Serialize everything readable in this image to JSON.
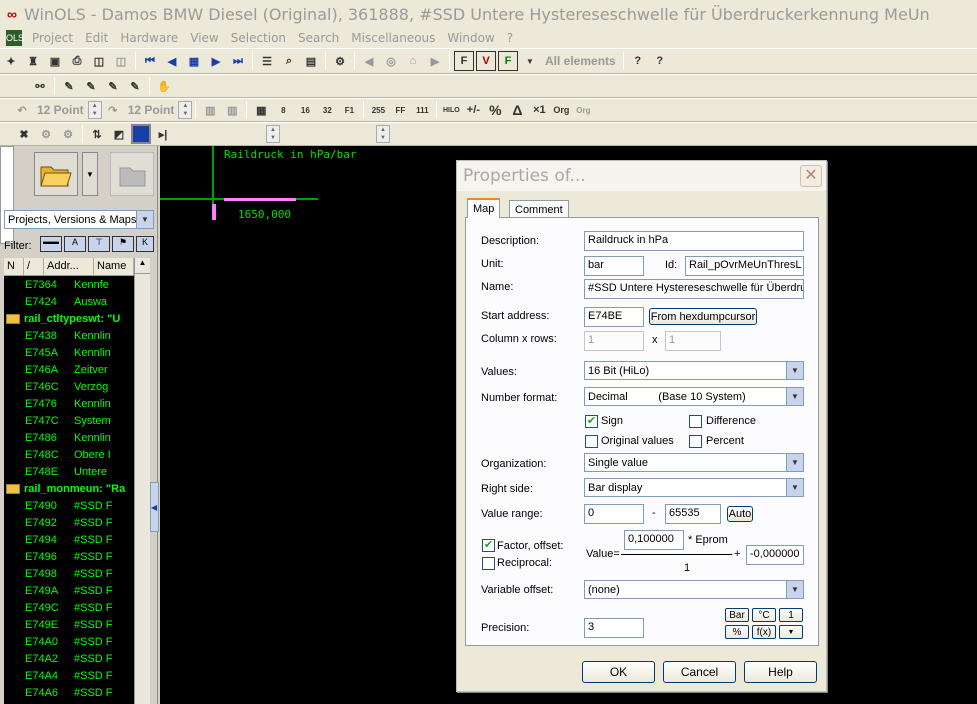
{
  "window": {
    "title": "WinOLS - Damos BMW Diesel (Original), 361888, #SSD Untere Hystereseschwelle für Überdruckerkennung MeUn"
  },
  "menu": [
    "Project",
    "Edit",
    "Hardware",
    "View",
    "Selection",
    "Search",
    "Miscellaneous",
    "Window",
    "?"
  ],
  "toolbar": {
    "filter_label": "All elements",
    "font1": "12 Point",
    "font2": "12 Point"
  },
  "leftpanel": {
    "combo_label": "Projects, Versions & Maps:",
    "filter_label": "Filter:",
    "list_columns": [
      "N",
      "/",
      "Addr...",
      "Name"
    ],
    "rows": [
      {
        "type": "item",
        "addr": "E7364",
        "name": "Kennfe"
      },
      {
        "type": "item",
        "addr": "E7424",
        "name": "Auswa"
      },
      {
        "type": "folder",
        "label": "rail_ctltypeswt: \"U"
      },
      {
        "type": "item",
        "addr": "E7438",
        "name": "Kennlin"
      },
      {
        "type": "item",
        "addr": "E745A",
        "name": "Kennlin"
      },
      {
        "type": "item",
        "addr": "E746A",
        "name": "Zeitver"
      },
      {
        "type": "item",
        "addr": "E746C",
        "name": "Verzög"
      },
      {
        "type": "item",
        "addr": "E7476",
        "name": "Kennlin"
      },
      {
        "type": "item",
        "addr": "E747C",
        "name": "System"
      },
      {
        "type": "item",
        "addr": "E7486",
        "name": "Kennlin"
      },
      {
        "type": "item",
        "addr": "E748C",
        "name": "Obere I"
      },
      {
        "type": "item",
        "addr": "E748E",
        "name": "Untere"
      },
      {
        "type": "folder",
        "label": "rail_monmeun: \"Ra"
      },
      {
        "type": "item",
        "addr": "E7490",
        "name": "#SSD F"
      },
      {
        "type": "item",
        "addr": "E7492",
        "name": "#SSD F"
      },
      {
        "type": "item",
        "addr": "E7494",
        "name": "#SSD F"
      },
      {
        "type": "item",
        "addr": "E7496",
        "name": "#SSD F"
      },
      {
        "type": "item",
        "addr": "E7498",
        "name": "#SSD F"
      },
      {
        "type": "item",
        "addr": "E749A",
        "name": "#SSD F"
      },
      {
        "type": "item",
        "addr": "E749C",
        "name": "#SSD F"
      },
      {
        "type": "item",
        "addr": "E749E",
        "name": "#SSD F"
      },
      {
        "type": "item",
        "addr": "E74A0",
        "name": "#SSD F"
      },
      {
        "type": "item",
        "addr": "E74A2",
        "name": "#SSD F"
      },
      {
        "type": "item",
        "addr": "E74A4",
        "name": "#SSD F"
      },
      {
        "type": "item",
        "addr": "E74A6",
        "name": "#SSD F"
      }
    ]
  },
  "map": {
    "axis_label": "Raildruck in hPa/bar",
    "value": "1650,000"
  },
  "dialog": {
    "title": "Properties of...",
    "tabs": [
      "Map",
      "Comment"
    ],
    "description_label": "Description:",
    "description": "Raildruck in hPa",
    "unit_label": "Unit:",
    "unit": "bar",
    "id_label": "Id:",
    "id": "Rail_pOvrMeUnThresL",
    "name_label": "Name:",
    "name": "#SSD Untere Hystereseschwelle für Überdru",
    "start_label": "Start address:",
    "start": "E74BE",
    "from_hexdump": "From hexdumpcursor",
    "colrows_label": "Column x rows:",
    "cols": "1",
    "x": "x",
    "rows": "1",
    "values_label": "Values:",
    "values": "16 Bit (HiLo)",
    "numfmt_label": "Number format:",
    "numfmt": "Decimal          (Base 10 System)",
    "sign": "Sign",
    "difference": "Difference",
    "original": "Original values",
    "percent": "Percent",
    "org_label": "Organization:",
    "org": "Single value",
    "right_label": "Right side:",
    "right": "Bar display",
    "range_label": "Value range:",
    "range_min": "0",
    "range_dash": "-",
    "range_max": "65535",
    "auto": "Auto",
    "factor_label": "Factor, offset:",
    "reciprocal_label": "Reciprocal:",
    "value_eq": "Value=",
    "factor": "0,100000",
    "eprom": "* Eprom",
    "plus": "+",
    "offset": "-0,000000",
    "denom": "1",
    "varoff_label": "Variable offset:",
    "varoff": "(none)",
    "precision_label": "Precision:",
    "precision": "3",
    "unit_btns": [
      "Bar",
      "°C",
      "1",
      "%",
      "f(x)",
      "▼"
    ],
    "ok": "OK",
    "cancel": "Cancel",
    "help": "Help"
  }
}
